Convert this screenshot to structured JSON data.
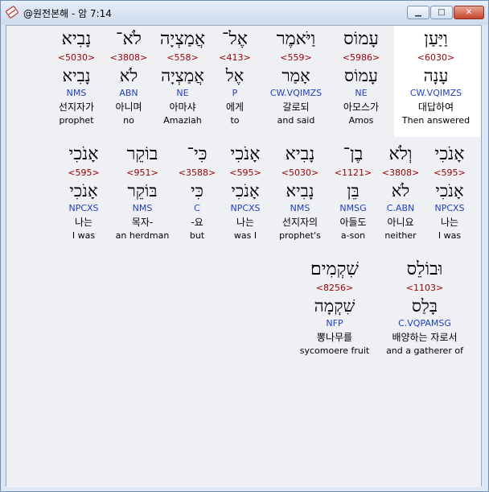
{
  "window": {
    "title": "@원전본해 - 암 7:14"
  },
  "controls": {
    "minimize": "▁",
    "maximize": "□",
    "close": "✕"
  },
  "words": [
    {
      "heb": "וַיַּעַן",
      "strong": "<6030>",
      "lex": "עָנָה",
      "parse": "CW.VQIMZS",
      "kor": "대답하여",
      "eng": "Then answered"
    },
    {
      "heb": "עָמוֹס",
      "strong": "<5986>",
      "lex": "עָמוֹס",
      "parse": "NE",
      "kor": "아모스가",
      "eng": "Amos"
    },
    {
      "heb": "וַיֹּאמֶר",
      "strong": "<559>",
      "lex": "אָמַר",
      "parse": "CW.VQIMZS",
      "kor": "갈로되",
      "eng": "and said"
    },
    {
      "heb": "אֶל־",
      "strong": "<413>",
      "lex": "אֶל",
      "parse": "P",
      "kor": "에게",
      "eng": "to"
    },
    {
      "heb": "אֲמַצְיָה",
      "strong": "<558>",
      "lex": "אֲמַצְיָה",
      "parse": "NE",
      "kor": "아마샤",
      "eng": "Amaziah"
    },
    {
      "heb": "לֹא־",
      "strong": "<3808>",
      "lex": "לֹא",
      "parse": "ABN",
      "kor": "아니며",
      "eng": "no"
    },
    {
      "heb": "נָבִיא",
      "strong": "<5030>",
      "lex": "נָבִיא",
      "parse": "NMS",
      "kor": "선지자가",
      "eng": "prophet"
    },
    {
      "heb": "אָנֹכִי",
      "strong": "<595>",
      "lex": "אָנֹכִי",
      "parse": "NPCXS",
      "kor": "나는",
      "eng": "I was"
    },
    {
      "heb": "וְלֹא",
      "strong": "<3808>",
      "lex": "לֹא",
      "parse": "C.ABN",
      "kor": "아니요",
      "eng": "neither"
    },
    {
      "heb": "בֶן־",
      "strong": "<1121>",
      "lex": "בֵּן",
      "parse": "NMSG",
      "kor": "아들도",
      "eng": "a-son"
    },
    {
      "heb": "נָבִיא",
      "strong": "<5030>",
      "lex": "נָבִיא",
      "parse": "NMS",
      "kor": "선지자의",
      "eng": "prophet's"
    },
    {
      "heb": "אָנֹכִי",
      "strong": "<595>",
      "lex": "אָנֹכִי",
      "parse": "NPCXS",
      "kor": "나는",
      "eng": "was I"
    },
    {
      "heb": "כִּי־",
      "strong": "<3588>",
      "lex": "כִּי",
      "parse": "C",
      "kor": "-요",
      "eng": "but"
    },
    {
      "heb": "בוֹקֵר",
      "strong": "<951>",
      "lex": "בּוֹקֵר",
      "parse": "NMS",
      "kor": "목자-",
      "eng": "an herdman"
    },
    {
      "heb": "אָנֹכִי",
      "strong": "<595>",
      "lex": "אָנֹכִי",
      "parse": "NPCXS",
      "kor": "나는",
      "eng": "I was"
    },
    {
      "heb": "וּבוֹלֵס",
      "strong": "<1103>",
      "lex": "בָּלַס",
      "parse": "C.VQPAMSG",
      "kor": "배양하는 자로서",
      "eng": "and a gatherer of"
    },
    {
      "heb": "שִׁקְמִים׃",
      "strong": "<8256>",
      "lex": "שִׁקְמָה",
      "parse": "NFP",
      "kor": "뽕나무를",
      "eng": "sycomoere fruit"
    }
  ]
}
